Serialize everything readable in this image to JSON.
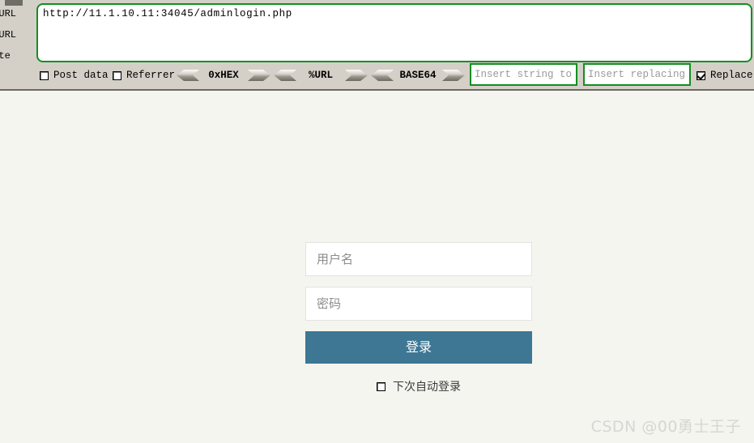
{
  "toolbar": {
    "url_value": "http://11.1.10.11:34045/adminlogin.php",
    "side_buttons": [
      {
        "label": "d URL"
      },
      {
        "label": "t URL"
      },
      {
        "label": "ute"
      }
    ],
    "checkboxes": [
      {
        "label": "Post data",
        "checked": false
      },
      {
        "label": "Referrer",
        "checked": false
      },
      {
        "label": "Replace A",
        "checked": true
      }
    ],
    "encoders": [
      {
        "label": "0xHEX"
      },
      {
        "label": "%URL"
      },
      {
        "label": "BASE64"
      }
    ],
    "replace_from_placeholder": "Insert string to repl",
    "replace_to_placeholder": "Insert replacing stri"
  },
  "login": {
    "username_placeholder": "用户名",
    "password_placeholder": "密码",
    "submit_label": "登录",
    "auto_login_label": "下次自动登录",
    "auto_login_checked": false,
    "accent_color": "#3d7794"
  },
  "watermark": {
    "text": "CSDN @00勇士王子"
  }
}
